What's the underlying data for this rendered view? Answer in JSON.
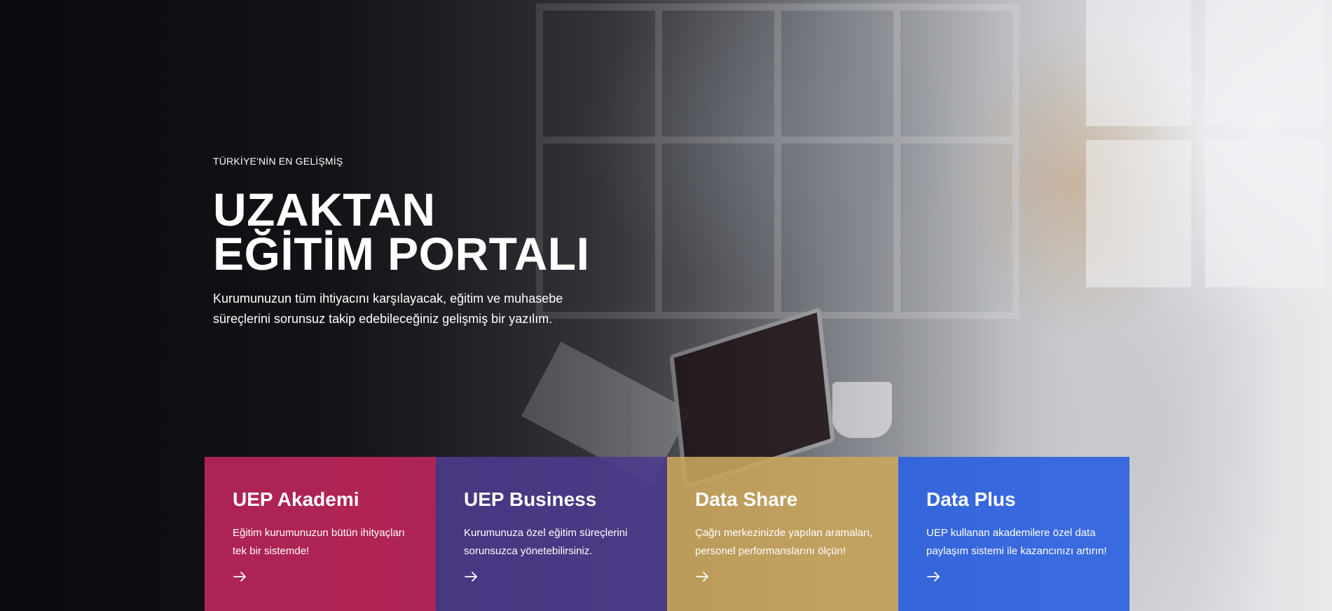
{
  "hero": {
    "eyebrow": "TÜRKİYE'NİN EN GELİŞMİŞ",
    "title_line1": "UZAKTAN",
    "title_line2": "EĞİTİM PORTALI",
    "description": "Kurumunuzun tüm ihtiyacını karşılayacak, eğitim ve muhasebe süreçlerini sorunsuz takip edebileceğiniz gelişmiş bir yazılım."
  },
  "cards": [
    {
      "title": "UEP Akademi",
      "description": "Eğitim kurumunuzun bütün ihityaçları tek bir sistemde!",
      "color": "#c0265c",
      "icon": "arrow-right-icon"
    },
    {
      "title": "UEP Business",
      "description": "Kurumunuza özel eğitim süreçlerini sorunsuzca yönetebilirsiniz.",
      "color": "#4d3a8c",
      "icon": "arrow-right-icon"
    },
    {
      "title": "Data Share",
      "description": "Çağrı merkezinizde yapılan aramaları, personel performanslarını ölçün!",
      "color": "#c9a45c",
      "icon": "arrow-right-icon"
    },
    {
      "title": "Data Plus",
      "description": "UEP kullanan akademilere özel data paylaşım sistemi ile kazancınızı artırın!",
      "color": "#2a5fe0",
      "icon": "arrow-right-icon"
    }
  ]
}
